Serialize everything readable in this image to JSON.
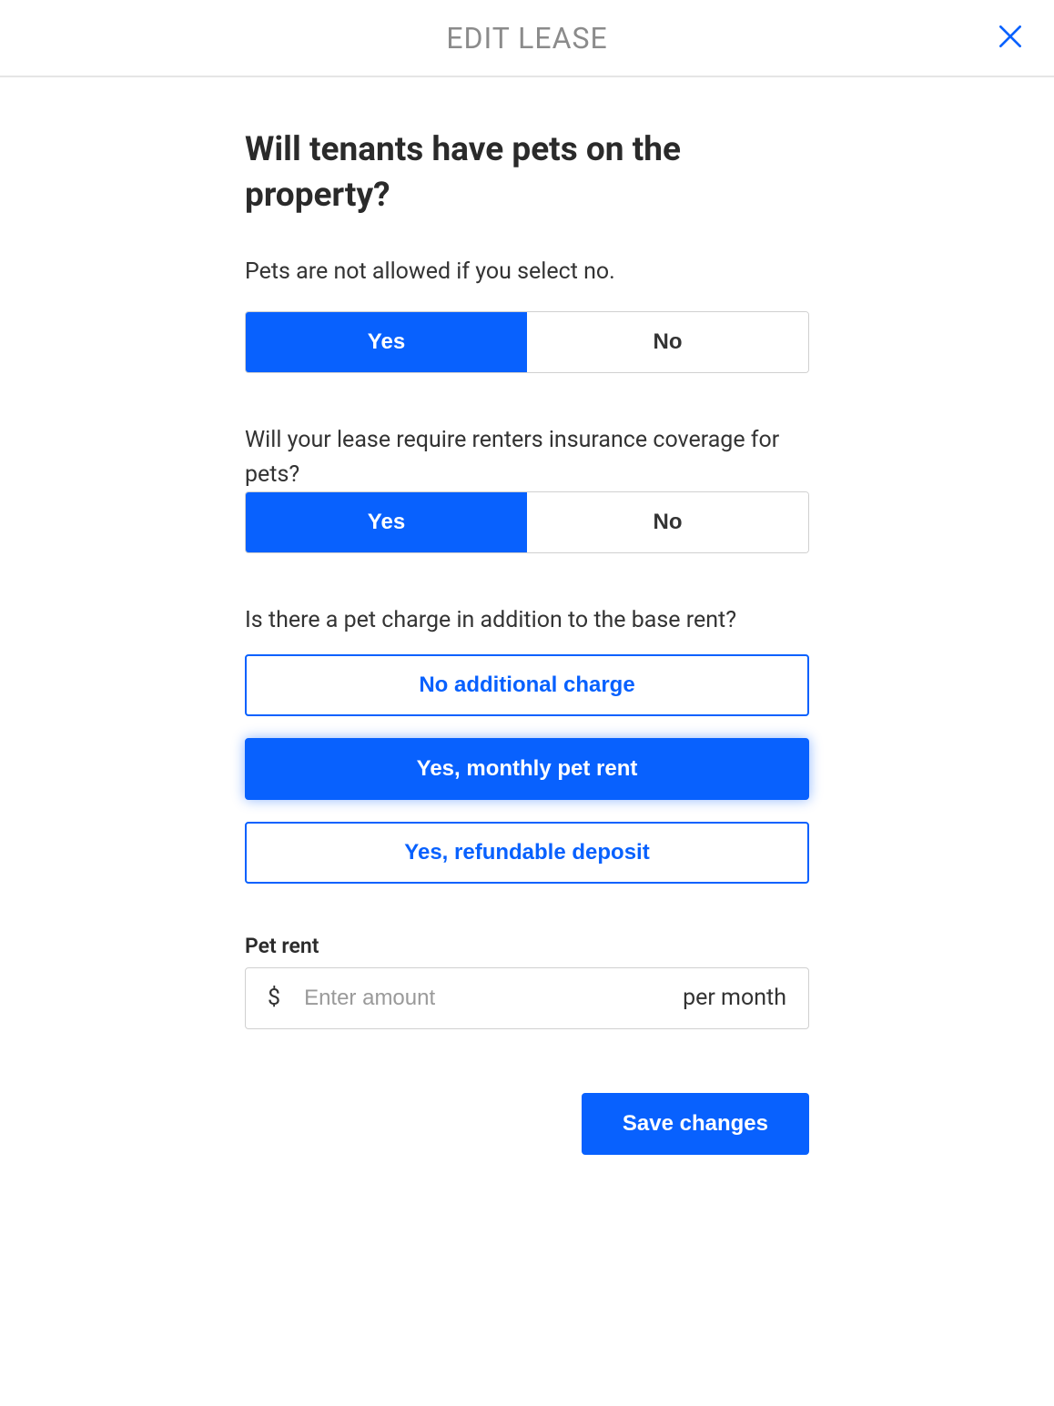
{
  "header": {
    "title": "EDIT LEASE"
  },
  "pets": {
    "heading": "Will tenants have pets on the property?",
    "subtext": "Pets are not allowed if you select no.",
    "yes": "Yes",
    "no": "No"
  },
  "insurance": {
    "question": "Will your lease require renters insurance coverage for pets?",
    "yes": "Yes",
    "no": "No"
  },
  "charge": {
    "question": "Is there a pet charge in addition to the base rent?",
    "options": {
      "none": "No additional charge",
      "monthly": "Yes, monthly pet rent",
      "deposit": "Yes, refundable deposit"
    }
  },
  "petRent": {
    "label": "Pet rent",
    "prefix": "$",
    "placeholder": "Enter amount",
    "suffix": "per month"
  },
  "actions": {
    "save": "Save changes"
  }
}
